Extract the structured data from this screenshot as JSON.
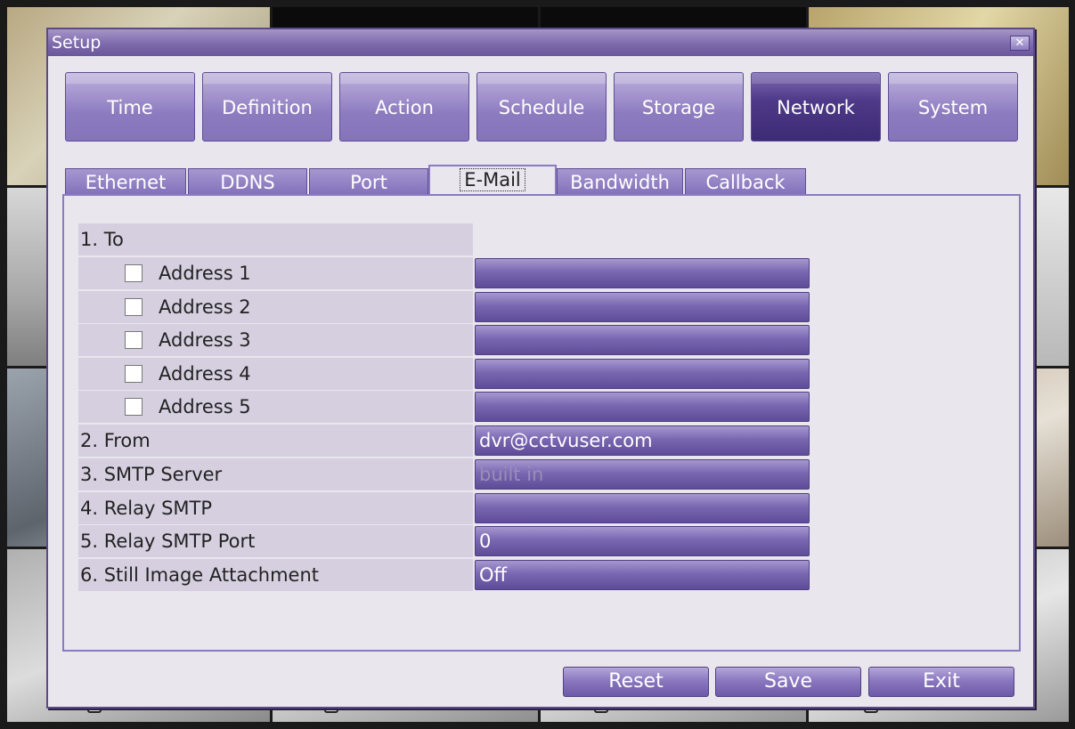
{
  "window": {
    "title": "Setup",
    "close_glyph": "✕"
  },
  "main_tabs": [
    {
      "label": "Time"
    },
    {
      "label": "Definition"
    },
    {
      "label": "Action"
    },
    {
      "label": "Schedule"
    },
    {
      "label": "Storage"
    },
    {
      "label": "Network",
      "active": true
    },
    {
      "label": "System"
    }
  ],
  "sub_tabs": [
    {
      "label": "Ethernet"
    },
    {
      "label": "DDNS"
    },
    {
      "label": "Port"
    },
    {
      "label": "E-Mail",
      "active": true
    },
    {
      "label": "Bandwidth"
    },
    {
      "label": "Callback"
    }
  ],
  "email": {
    "to_label": "1. To",
    "addresses": [
      {
        "label": "Address 1",
        "checked": false,
        "value": ""
      },
      {
        "label": "Address 2",
        "checked": false,
        "value": ""
      },
      {
        "label": "Address 3",
        "checked": false,
        "value": ""
      },
      {
        "label": "Address 4",
        "checked": false,
        "value": ""
      },
      {
        "label": "Address 5",
        "checked": false,
        "value": ""
      }
    ],
    "from_label": "2. From",
    "from_value": "dvr@cctvuser.com",
    "smtp_label": "3. SMTP Server",
    "smtp_value": "built in",
    "relay_label": "4. Relay SMTP",
    "relay_value": "",
    "relay_port_label": "5. Relay SMTP Port",
    "relay_port_value": "0",
    "attach_label": "6. Still Image Attachment",
    "attach_value": "Off"
  },
  "buttons": {
    "reset": "Reset",
    "save": "Save",
    "exit": "Exit"
  }
}
